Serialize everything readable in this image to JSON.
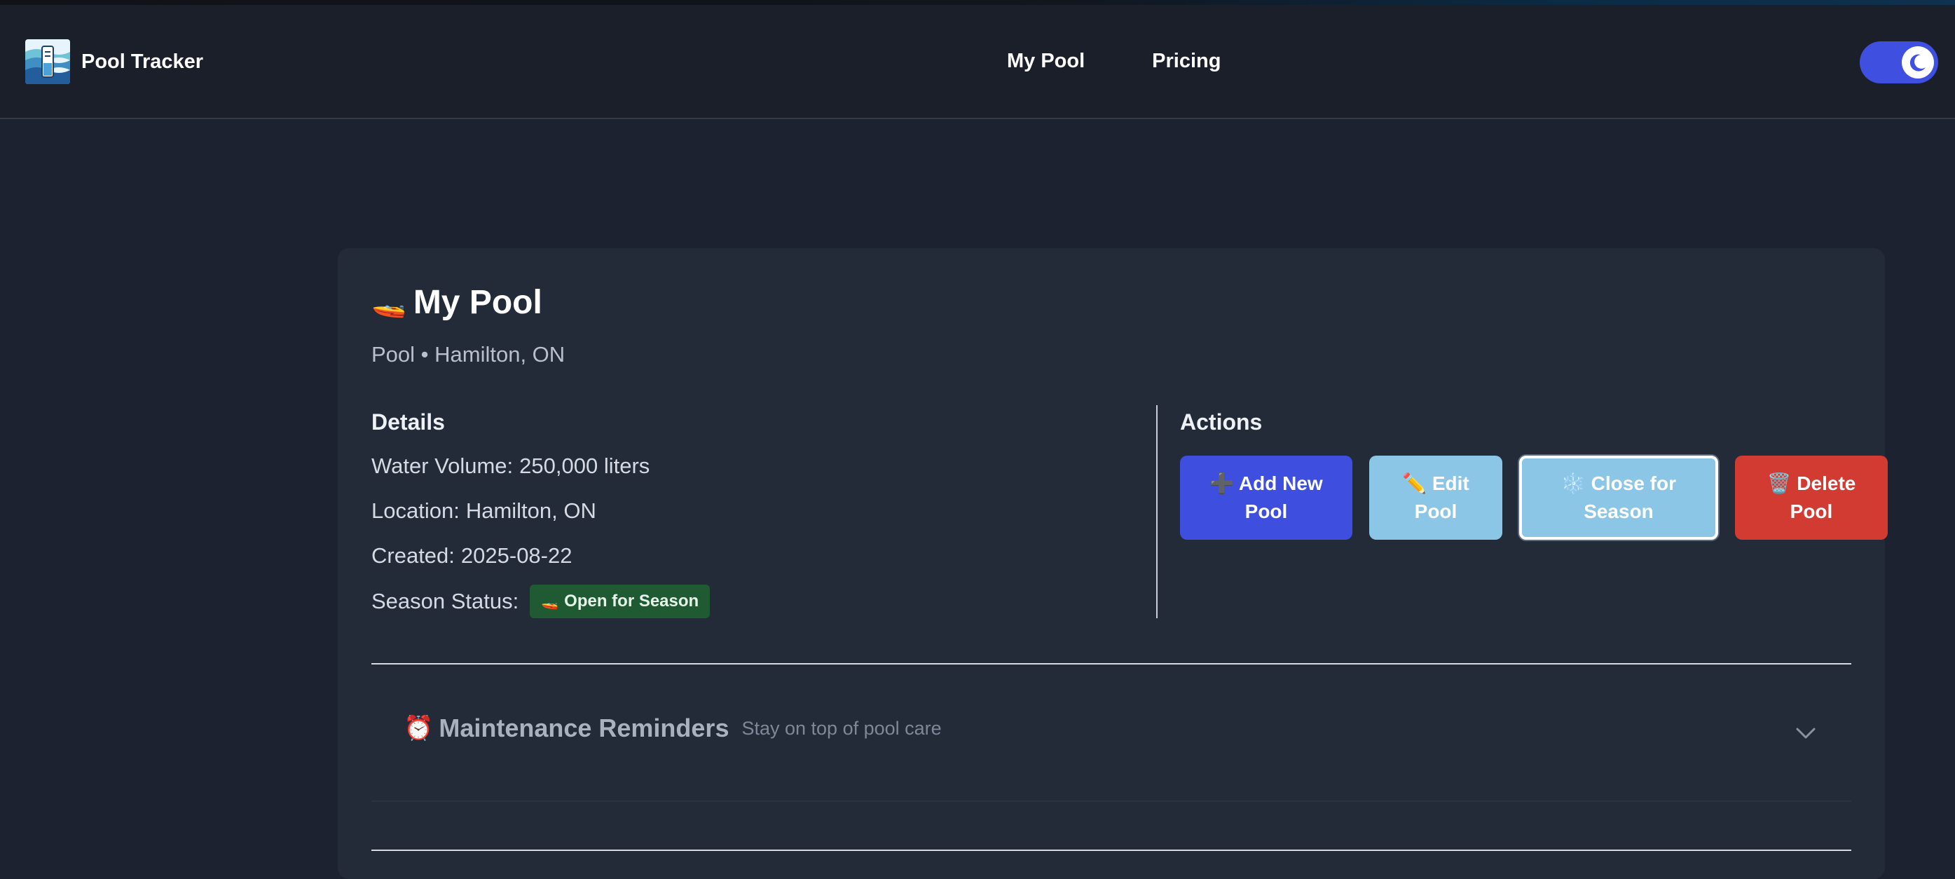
{
  "app": {
    "name": "Pool Tracker"
  },
  "nav": {
    "items": [
      {
        "label": "My Pool"
      },
      {
        "label": "Pricing"
      }
    ]
  },
  "theme_toggle": {
    "mode": "dark",
    "accent": "#3f4fe0"
  },
  "pool": {
    "title_icon": "🚤",
    "title": "My Pool",
    "subtitle": "Pool • Hamilton, ON"
  },
  "details": {
    "heading": "Details",
    "water_volume_label": "Water Volume:",
    "water_volume_value": "250,000 liters",
    "location_label": "Location:",
    "location_value": "Hamilton, ON",
    "created_label": "Created:",
    "created_value": "2025-08-22",
    "season_status_label": "Season Status:",
    "season_status_badge_icon": "🚤",
    "season_status_badge": "Open for Season"
  },
  "actions": {
    "heading": "Actions",
    "add_icon": "➕",
    "add_line1": "Add New",
    "add_line2": "Pool",
    "edit_icon": "✏️",
    "edit_line1": "Edit",
    "edit_line2": "Pool",
    "close_icon": "❄️",
    "close_line1": "Close for",
    "close_line2": "Season",
    "delete_icon": "🗑️",
    "delete_line1": "Delete",
    "delete_line2": "Pool"
  },
  "reminders": {
    "icon": "⏰",
    "title": "Maintenance Reminders",
    "subtitle": "Stay on top of pool care",
    "expanded": false
  },
  "colors": {
    "background": "#1d2230",
    "card": "#232a38",
    "primary": "#3e4fe0",
    "light_blue": "#8cc6e6",
    "danger": "#d23b32",
    "success_badge": "#1f5a32"
  }
}
